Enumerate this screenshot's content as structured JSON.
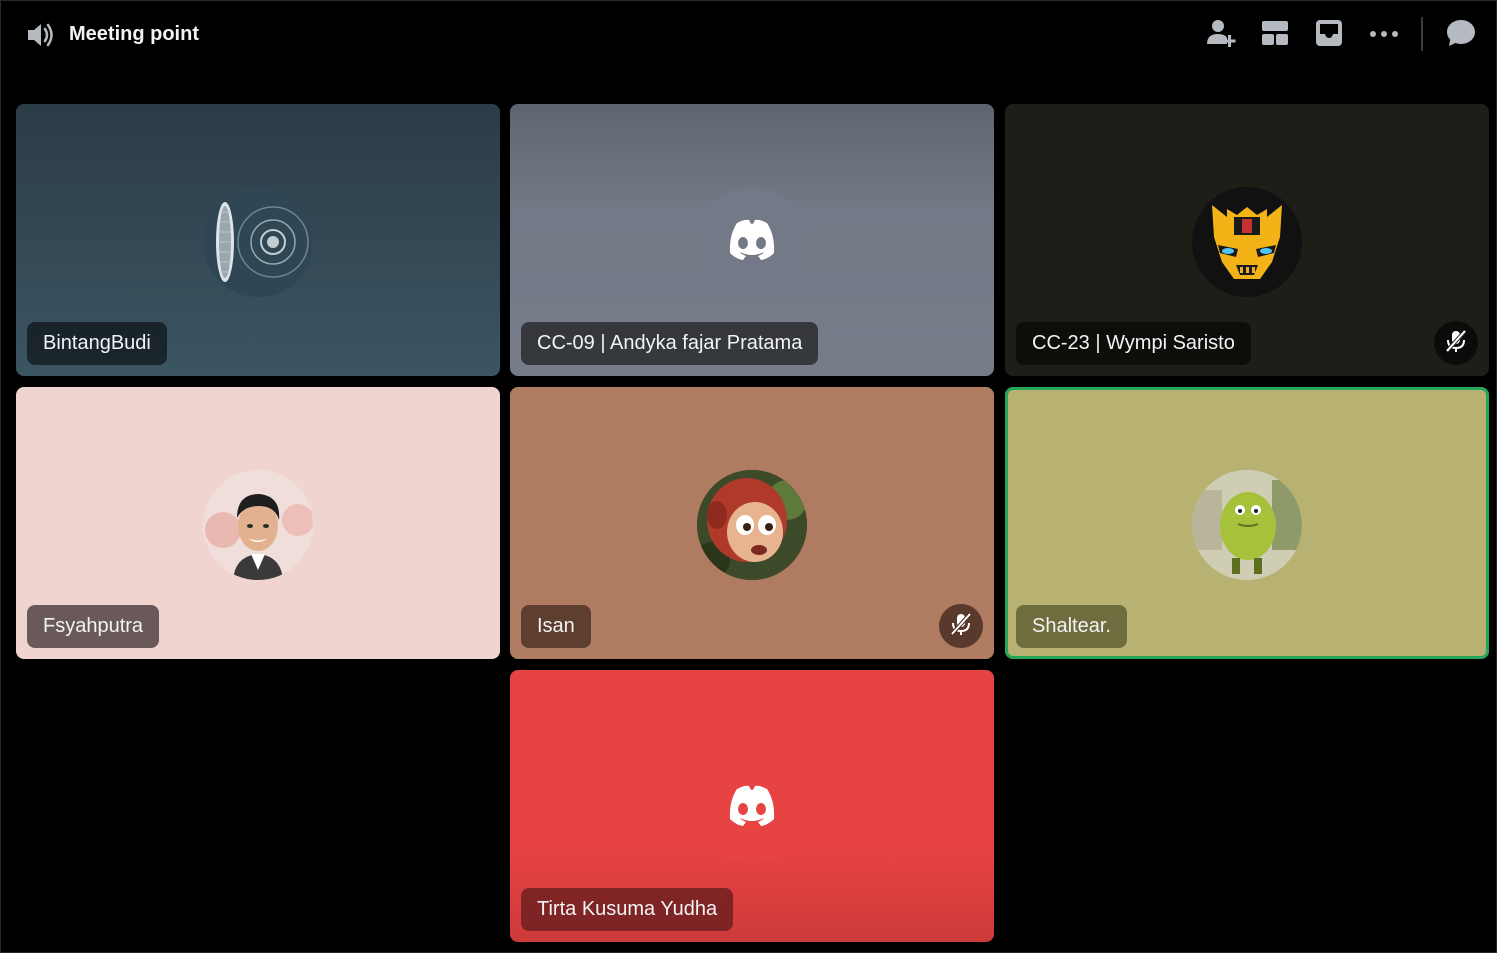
{
  "header": {
    "channel_icon": "speaker-icon",
    "title": "Meeting point",
    "actions": [
      {
        "name": "add-member-button",
        "icon": "add-person-icon"
      },
      {
        "name": "layout-button",
        "icon": "grid-layout-icon"
      },
      {
        "name": "inbox-button",
        "icon": "inbox-icon"
      },
      {
        "name": "more-options-button",
        "icon": "ellipsis-icon"
      },
      {
        "name": "chat-button",
        "icon": "chat-bubble-icon"
      }
    ]
  },
  "participants": [
    {
      "name": "BintangBudi",
      "avatar": "wheel-avatar",
      "tile_color": "#2f4654",
      "muted": false,
      "speaking": false
    },
    {
      "name": "CC-09 | Andyka fajar Pratama",
      "avatar": "discord-default-avatar",
      "tile_color": "#737986",
      "muted": false,
      "speaking": false
    },
    {
      "name": "CC-23 | Wympi Saristo",
      "avatar": "bumblebee-avatar",
      "tile_color": "#1f1d17",
      "muted": true,
      "speaking": false
    },
    {
      "name": "Fsyahputra",
      "avatar": "photo-avatar",
      "tile_color": "#efd4d0",
      "muted": false,
      "speaking": false
    },
    {
      "name": "Isan",
      "avatar": "monkey-avatar",
      "tile_color": "#af7c61",
      "muted": true,
      "speaking": false
    },
    {
      "name": "Shaltear.",
      "avatar": "green-creature-avatar",
      "tile_color": "#b7b172",
      "muted": false,
      "speaking": true
    },
    {
      "name": "Tirta Kusuma Yudha",
      "avatar": "discord-default-avatar",
      "tile_color": "#e84343",
      "muted": false,
      "speaking": false
    }
  ],
  "colors": {
    "background": "#000000",
    "speaking_ring": "#23a55a",
    "discord_blurple_white": "#ffffff"
  }
}
